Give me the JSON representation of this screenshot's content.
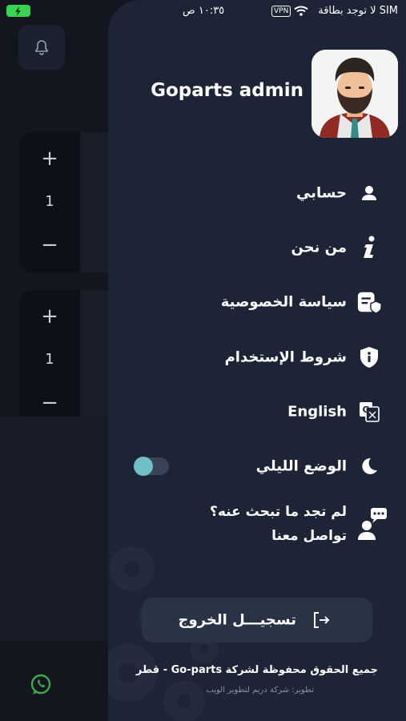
{
  "status_bar": {
    "carrier": "لا توجد بطاقة SIM",
    "vpn": "VPN",
    "time": "١٠:٣٥ ص"
  },
  "background": {
    "cards": [
      {
        "plus": "+",
        "quantity": "1",
        "minus": "−"
      },
      {
        "plus": "+",
        "quantity": "1",
        "minus": "−"
      }
    ]
  },
  "drawer": {
    "profile": {
      "name": "Goparts admin"
    },
    "menu": [
      {
        "label": "حسابي",
        "icon": "person-icon"
      },
      {
        "label": "من نحن",
        "icon": "info-icon"
      },
      {
        "label": "سياسة الخصوصية",
        "icon": "privacy-policy-icon"
      },
      {
        "label": "شروط الإستخدام",
        "icon": "shield-info-icon"
      },
      {
        "label": "English",
        "icon": "translate-icon"
      },
      {
        "label": "الوضع الليلي",
        "icon": "moon-icon"
      }
    ],
    "night_mode_on": false,
    "contact": {
      "line1": "لم تجد ما تبحث عنه؟",
      "line2": "تواصل معنا",
      "icon": "support-chat-icon"
    },
    "logout_label": "تسجيـــل الخروج",
    "copyright": "جميع الحقوق محفوظة لشركة Go-parts - قطر",
    "developer": "تطوير: شركة دريم لتطوير الويب"
  },
  "colors": {
    "drawer_bg": "#1d2436",
    "accent": "#6fbfc5",
    "page_bg": "#13161e"
  }
}
